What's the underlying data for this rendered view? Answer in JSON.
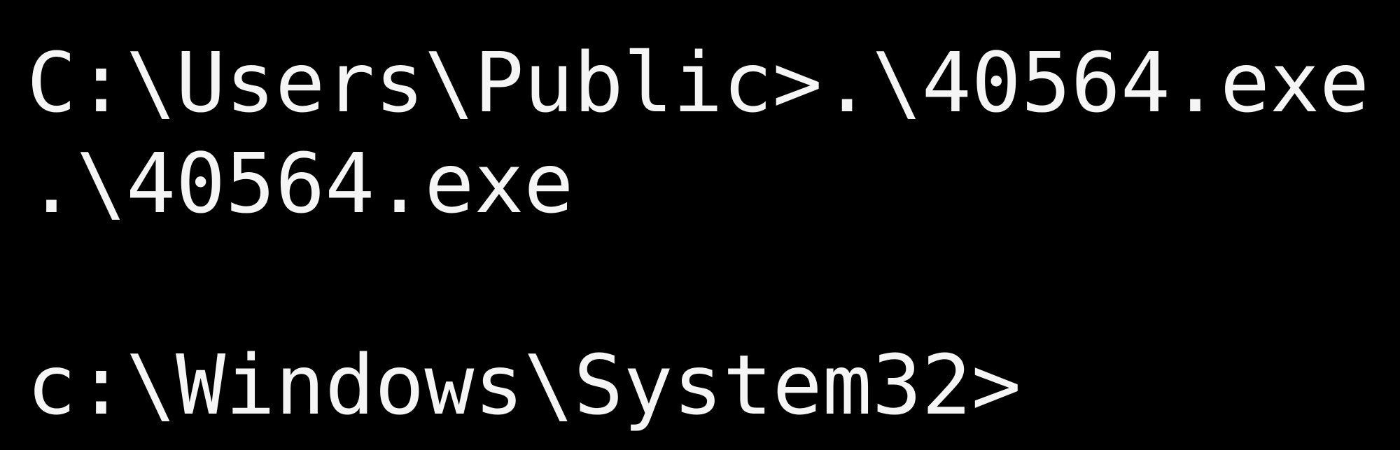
{
  "terminal": {
    "lines": [
      "C:\\Users\\Public>.\\40564.exe",
      ".\\40564.exe",
      "",
      "c:\\Windows\\System32>"
    ]
  },
  "colors": {
    "background": "#000000",
    "foreground": "#f5f5f5"
  }
}
